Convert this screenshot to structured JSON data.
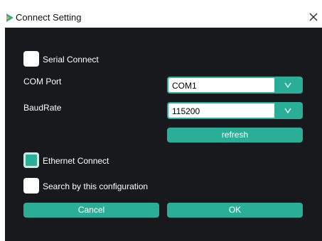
{
  "window": {
    "title": "Connect Setting",
    "app_icon": "app-logo-icon",
    "close_icon": "close-icon"
  },
  "serial": {
    "checkbox_label": "Serial Connect",
    "checked": false,
    "com_port_label": "COM Port",
    "com_port_value": "COM1",
    "baud_rate_label": "BaudRate",
    "baud_rate_value": "115200",
    "dropdown_icon": "chevron-down-icon",
    "refresh_label": "refresh"
  },
  "ethernet": {
    "checkbox_label": "Ethernet Connect",
    "checked": true
  },
  "search_config": {
    "checkbox_label": "Search by this configuration",
    "checked": false
  },
  "actions": {
    "cancel_label": "Cancel",
    "ok_label": "OK"
  },
  "colors": {
    "accent": "#2bae97",
    "background": "#17191d",
    "titlebar": "#ffffff"
  }
}
